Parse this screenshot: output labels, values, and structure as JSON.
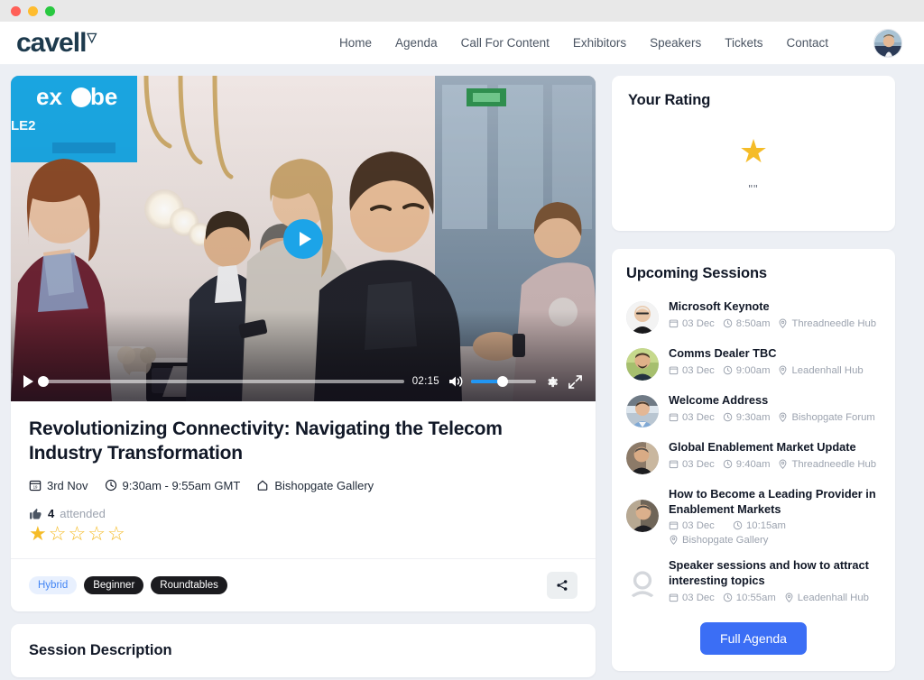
{
  "window": {
    "traffic_lights": [
      "close",
      "minimize",
      "maximize"
    ]
  },
  "nav": {
    "logo_text": "cavell",
    "logo_mark": "▽",
    "links": [
      {
        "label": "Home"
      },
      {
        "label": "Agenda"
      },
      {
        "label": "Call For Content"
      },
      {
        "label": "Exhibitors"
      },
      {
        "label": "Speakers"
      },
      {
        "label": "Tickets"
      },
      {
        "label": "Contact"
      }
    ],
    "avatar_icon": "user-avatar"
  },
  "video": {
    "play_overlay_icon": "play-icon",
    "controls": {
      "play_icon": "play-icon",
      "current_time": "02:15",
      "progress_percent": 0,
      "volume_icon": "volume-icon",
      "volume_percent": 48,
      "settings_icon": "gear-icon",
      "fullscreen_icon": "fullscreen-icon"
    }
  },
  "session": {
    "title": "Revolutionizing Connectivity: Navigating the Telecom Industry Transformation",
    "meta": {
      "date_icon": "calendar-icon",
      "date": "3rd Nov",
      "time_icon": "clock-icon",
      "time": "9:30am - 9:55am GMT",
      "location_icon": "venue-icon",
      "location": "Bishopgate Gallery"
    },
    "attendance": {
      "icon": "thumbs-up-icon",
      "count": "4",
      "label": "attended"
    },
    "rating": {
      "filled": 1,
      "total": 5,
      "filled_glyph": "★",
      "empty_glyph": "☆"
    },
    "tags": [
      {
        "label": "Hybrid",
        "style": "blue"
      },
      {
        "label": "Beginner",
        "style": "dark"
      },
      {
        "label": "Roundtables",
        "style": "dark"
      }
    ],
    "share_icon": "share-icon"
  },
  "description": {
    "title": "Session Description"
  },
  "your_rating": {
    "title": "Your Rating",
    "star_glyph": "★",
    "review_text": "\"\""
  },
  "upcoming": {
    "title": "Upcoming Sessions",
    "date_icon": "calendar-icon",
    "time_icon": "clock-icon",
    "location_icon": "pin-icon",
    "items": [
      {
        "name": "Microsoft Keynote",
        "date": "03 Dec",
        "time": "8:50am",
        "location": "Threadneedle Hub",
        "avatar": "speaker-photo"
      },
      {
        "name": "Comms Dealer TBC",
        "date": "03 Dec",
        "time": "9:00am",
        "location": "Leadenhall Hub",
        "avatar": "speaker-photo"
      },
      {
        "name": "Welcome Address",
        "date": "03 Dec",
        "time": "9:30am",
        "location": "Bishopgate Forum",
        "avatar": "speaker-photo"
      },
      {
        "name": "Global Enablement Market Update",
        "date": "03 Dec",
        "time": "9:40am",
        "location": "Threadneedle Hub",
        "avatar": "speaker-photo"
      },
      {
        "name": "How to Become a Leading Provider in Enablement Markets",
        "date": "03 Dec",
        "time": "10:15am",
        "location": "Bishopgate Gallery",
        "avatar": "speaker-photo"
      },
      {
        "name": "Speaker sessions and how to attract interesting topics",
        "date": "03 Dec",
        "time": "10:55am",
        "location": "Leadenhall Hub",
        "avatar": "placeholder-avatar"
      }
    ],
    "full_agenda_label": "Full Agenda"
  },
  "colors": {
    "brand_navy": "#1d3a4d",
    "accent_blue": "#3b6ef5",
    "play_blue": "#1ca4e8",
    "star_yellow": "#f5bc28",
    "tag_blue_text": "#4285f4",
    "page_bg": "#eceff4"
  }
}
